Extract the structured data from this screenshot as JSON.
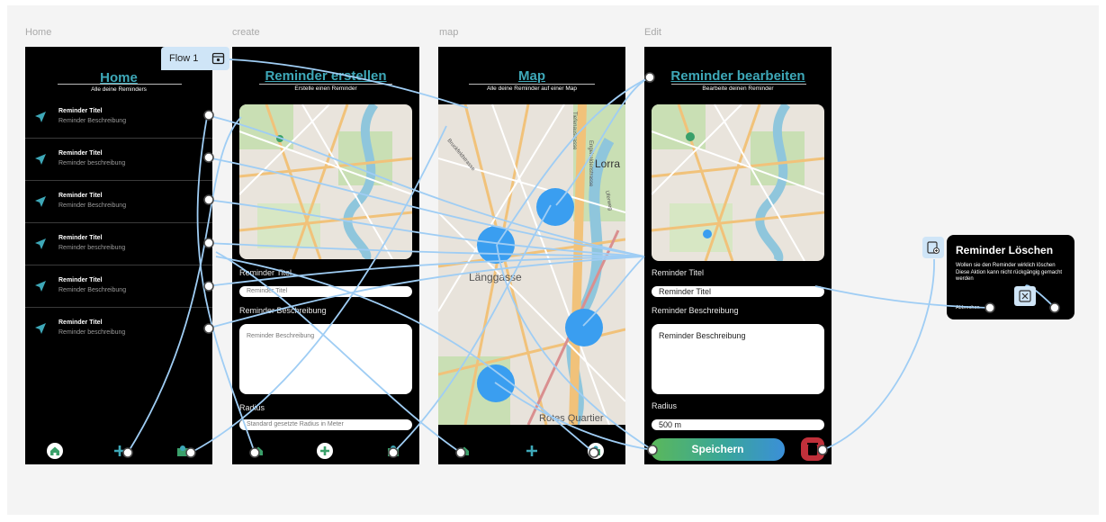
{
  "canvas": {
    "frame_labels": [
      "Home",
      "create",
      "map",
      "Edit"
    ],
    "flow_label": "Flow 1"
  },
  "home": {
    "title": "Home",
    "subtitle": "Alle deine Reminders",
    "items": [
      {
        "title": "Reminder Titel",
        "desc": "Reminder Beschreibung"
      },
      {
        "title": "Reminder Titel",
        "desc": "Reminder beschreibung"
      },
      {
        "title": "Reminder Titel",
        "desc": "Reminder Beschreibung"
      },
      {
        "title": "Reminder Titel",
        "desc": "Reminder beschreibung"
      },
      {
        "title": "Reminder Titel",
        "desc": "Reminder Beschreibung"
      },
      {
        "title": "Reminder Titel",
        "desc": "Reminder beschreibung"
      }
    ]
  },
  "create": {
    "title": "Reminder erstellen",
    "subtitle": "Erstelle einen Reminder",
    "title_label": "Reminder Titel",
    "title_placeholder": "Reminder Titel",
    "desc_label": "Reminder Beschreibung",
    "desc_placeholder": "Reminder Beschreibung",
    "radius_label": "Radius",
    "radius_placeholder": "Standard gesetzte Radius in Meter"
  },
  "map": {
    "title": "Map",
    "subtitle": "Alle deine Reminder auf einer Map",
    "place_labels": [
      "Lorra",
      "Länggasse",
      "Rotes Quartier",
      "Bruckfeldstrasse",
      "Tiefenaustrasse",
      "Engehaldenstrasse",
      "Uferweg"
    ]
  },
  "edit": {
    "title": "Reminder bearbeiten",
    "subtitle": "Bearbeite deinen Reminder",
    "title_label": "Reminder Titel",
    "title_value": "Reminder Titel",
    "desc_label": "Reminder Beschreibung",
    "desc_value": "Reminder Beschreibung",
    "radius_label": "Radius",
    "radius_value": "500 m",
    "save_label": "Speichern"
  },
  "dialog": {
    "title": "Reminder Löschen",
    "body": "Wollen sie den Reminder wirklich löschen Diese Aktion kann nicht rückgängig gemacht werden",
    "cancel": "Abbrechen"
  },
  "colors": {
    "accent": "#3ea8b8",
    "connector": "#9fcdf4",
    "pin": "#3a9ef0",
    "delete": "#c0303a"
  },
  "icons": [
    "home-icon",
    "plus-icon",
    "map-icon",
    "navigation-arrow-icon",
    "trash-icon",
    "close-icon",
    "calendar-icon",
    "add-overlay-icon"
  ]
}
